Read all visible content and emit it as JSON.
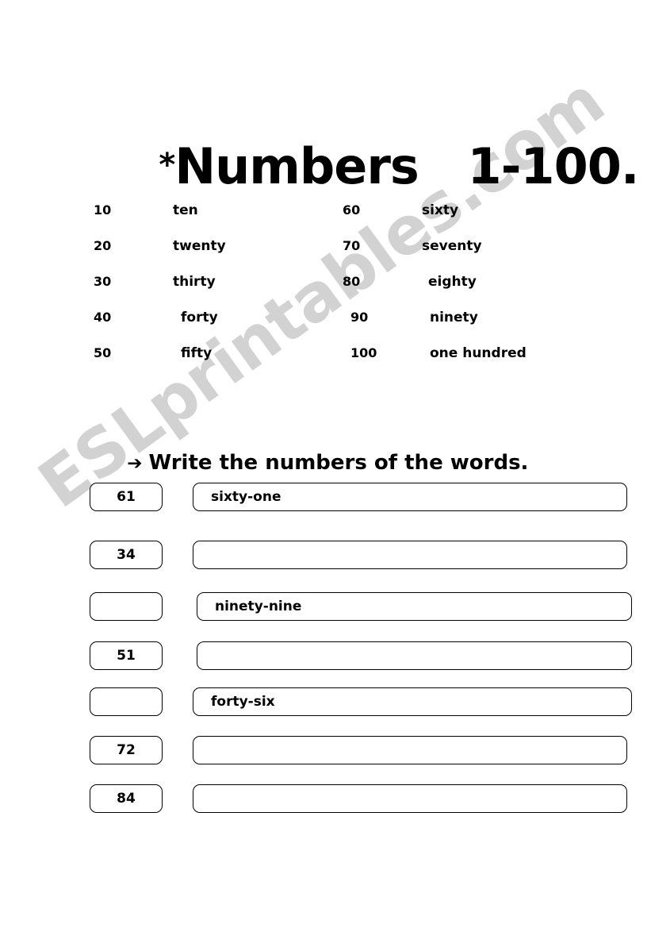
{
  "title": {
    "star": "*",
    "text": "Numbers   1-100."
  },
  "number_table": {
    "left_column": [
      {
        "number": "10",
        "word": "ten"
      },
      {
        "number": "20",
        "word": "twenty"
      },
      {
        "number": "30",
        "word": "thirty"
      },
      {
        "number": "40",
        "word": "forty"
      },
      {
        "number": "50",
        "word": "fifty"
      }
    ],
    "right_column": [
      {
        "number": "60",
        "word": "sixty"
      },
      {
        "number": "70",
        "word": "seventy"
      },
      {
        "number": "80",
        "word": "eighty"
      },
      {
        "number": "90",
        "word": "ninety"
      },
      {
        "number": "100",
        "word": "one hundred"
      }
    ]
  },
  "instruction": {
    "arrow": "➔",
    "text": "Write the numbers of the words."
  },
  "exercise": {
    "rows": [
      {
        "number": "61",
        "word": "sixty-one"
      },
      {
        "number": "34",
        "word": ""
      },
      {
        "number": "",
        "word": "ninety-nine"
      },
      {
        "number": "51",
        "word": ""
      },
      {
        "number": "",
        "word": "forty-six"
      },
      {
        "number": "72",
        "word": ""
      },
      {
        "number": "84",
        "word": ""
      }
    ]
  },
  "watermark": {
    "text": "ESLprintables.com",
    "color": "#d2d2d2"
  },
  "colors": {
    "background": "#ffffff",
    "ink": "#000000",
    "box_border": "#000000"
  }
}
